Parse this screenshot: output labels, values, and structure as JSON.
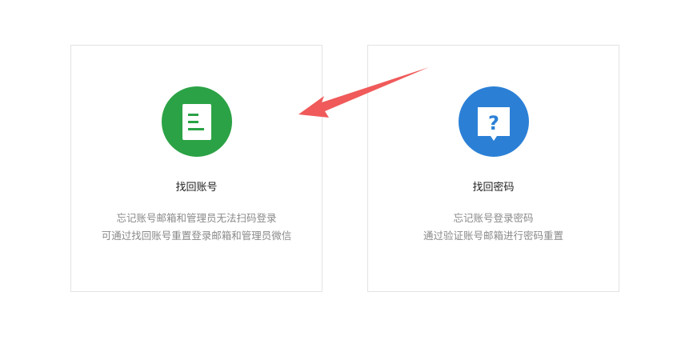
{
  "cards": [
    {
      "title": "找回账号",
      "desc_line1": "忘记账号邮箱和管理员无法扫码登录",
      "desc_line2": "可通过找回账号重置登录邮箱和管理员微信",
      "icon": "document-icon",
      "icon_color": "#2ba245"
    },
    {
      "title": "找回密码",
      "desc_line1": "忘记账号登录密码",
      "desc_line2": "通过验证账号邮箱进行密码重置",
      "icon": "question-icon",
      "icon_color": "#2b80d6"
    }
  ],
  "annotation": {
    "arrow_color": "#f05a5a",
    "points_to": "找回账号"
  }
}
